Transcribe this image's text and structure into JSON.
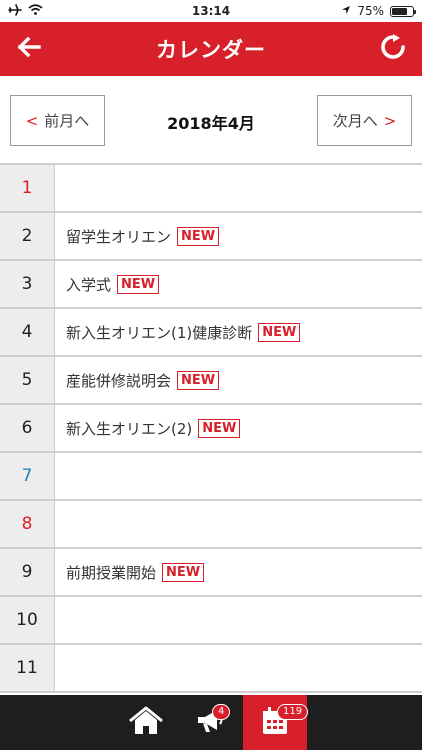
{
  "status_bar": {
    "time": "13:14",
    "battery_percent": "75%",
    "battery_level": 0.75,
    "icons": [
      "airplane-icon",
      "wifi-icon",
      "location-arrow-icon",
      "battery-icon"
    ]
  },
  "header": {
    "title": "カレンダー",
    "back_icon": "arrow-left-icon",
    "refresh_icon": "refresh-icon",
    "color": "#d8202a"
  },
  "month_nav": {
    "prev_label": "前月へ",
    "prev_arrow": "<",
    "next_label": "次月へ",
    "next_arrow": ">",
    "current_month": "2018年4月"
  },
  "days": [
    {
      "num": "1",
      "type": "sunday",
      "event": "",
      "badge": ""
    },
    {
      "num": "2",
      "type": "weekday",
      "event": "留学生オリエン",
      "badge": "NEW"
    },
    {
      "num": "3",
      "type": "weekday",
      "event": "入学式",
      "badge": "NEW"
    },
    {
      "num": "4",
      "type": "weekday",
      "event": "新入生オリエン(1)健康診断",
      "badge": "NEW"
    },
    {
      "num": "5",
      "type": "weekday",
      "event": "産能併修説明会",
      "badge": "NEW"
    },
    {
      "num": "6",
      "type": "weekday",
      "event": "新入生オリエン(2)",
      "badge": "NEW"
    },
    {
      "num": "7",
      "type": "saturday",
      "event": "",
      "badge": ""
    },
    {
      "num": "8",
      "type": "sunday",
      "event": "",
      "badge": ""
    },
    {
      "num": "9",
      "type": "weekday",
      "event": "前期授業開始",
      "badge": "NEW"
    },
    {
      "num": "10",
      "type": "weekday",
      "event": "",
      "badge": ""
    },
    {
      "num": "11",
      "type": "weekday",
      "event": "",
      "badge": ""
    }
  ],
  "tab_bar": {
    "home_icon": "home-icon",
    "notice_icon": "megaphone-icon",
    "notice_badge": "4",
    "calendar_icon": "calendar-icon",
    "calendar_badge": "119"
  },
  "colors": {
    "accent": "#d8202a",
    "saturday": "#1e86b3",
    "tab_bar": "#1e1e1e"
  }
}
